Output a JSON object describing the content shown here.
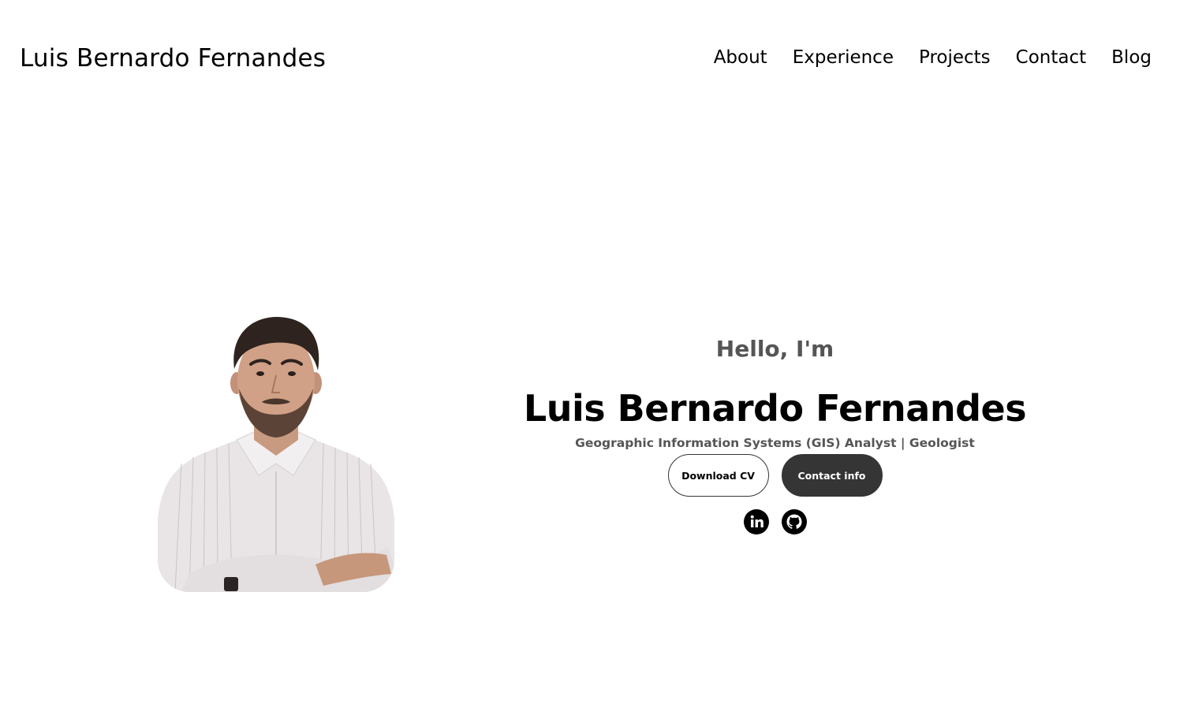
{
  "header": {
    "logo": "Luis Bernardo Fernandes",
    "nav": [
      {
        "label": "About"
      },
      {
        "label": "Experience"
      },
      {
        "label": "Projects"
      },
      {
        "label": "Contact"
      },
      {
        "label": "Blog"
      }
    ]
  },
  "hero": {
    "greeting": "Hello, I'm",
    "name": "Luis Bernardo Fernandes",
    "role": "Geographic Information Systems (GIS) Analyst | Geologist",
    "buttons": {
      "download_cv": "Download CV",
      "contact_info": "Contact info"
    },
    "socials": [
      {
        "icon": "linkedin-icon"
      },
      {
        "icon": "github-icon"
      }
    ]
  },
  "colors": {
    "text": "#000000",
    "muted_text": "#555555",
    "button_dark": "#353535",
    "background": "#ffffff"
  }
}
